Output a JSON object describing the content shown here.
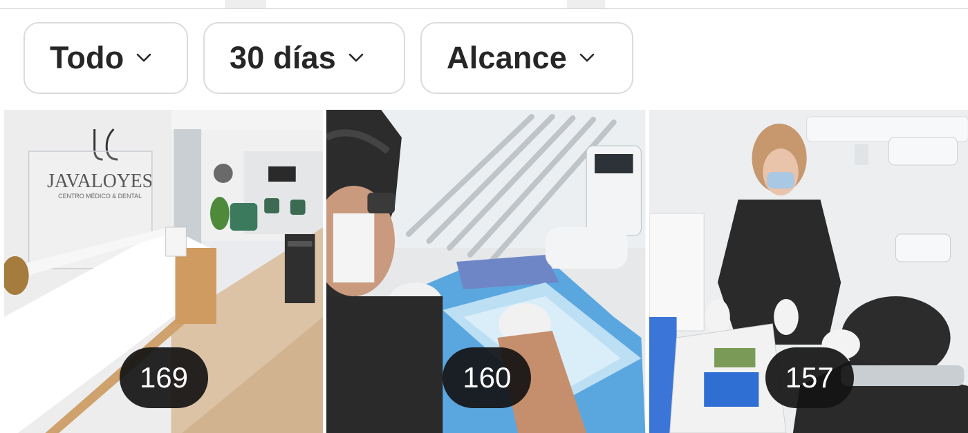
{
  "filters": [
    {
      "label": "Todo"
    },
    {
      "label": "30 días"
    },
    {
      "label": "Alcance"
    }
  ],
  "posts": [
    {
      "metric": "169",
      "logo_text": "JAVALOYES",
      "logo_subtext": "CENTRO MÉDICO & DENTAL"
    },
    {
      "metric": "160"
    },
    {
      "metric": "157"
    }
  ],
  "colors": {
    "chip_border": "#dbdbdb",
    "chip_text": "#262626",
    "badge_bg": "#141414",
    "badge_text": "#ffffff"
  }
}
